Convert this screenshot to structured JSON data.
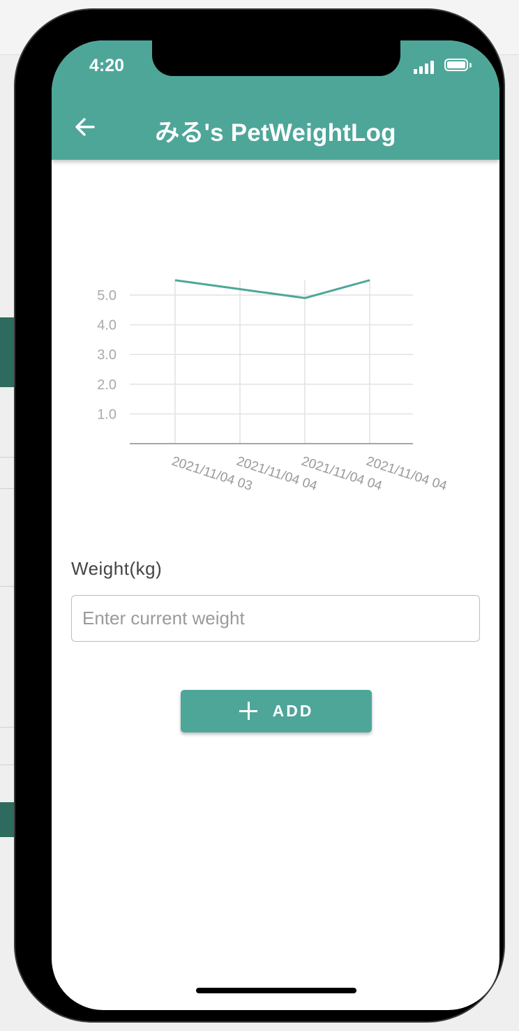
{
  "status_bar": {
    "time": "4:20"
  },
  "app_bar": {
    "title": "みる's PetWeightLog",
    "back_icon": "arrow-left-icon"
  },
  "chart_data": {
    "type": "line",
    "categories": [
      "2021/11/04 03",
      "2021/11/04 04",
      "2021/11/04 04",
      "2021/11/04 04"
    ],
    "series": [
      {
        "values": [
          5.5,
          5.2,
          4.9,
          5.5
        ],
        "color": "#4ea699"
      }
    ],
    "yticks": [
      "1.0",
      "2.0",
      "3.0",
      "4.0",
      "5.0"
    ],
    "ylim": [
      0,
      5.5
    ],
    "grid": true,
    "xlabel": "",
    "ylabel": "",
    "title": ""
  },
  "form": {
    "weight_label": "Weight(kg)",
    "weight_placeholder": "Enter current weight",
    "weight_value": ""
  },
  "add_button": {
    "label": "ADD",
    "icon": "plus-icon"
  },
  "colors": {
    "primary": "#4ea699",
    "background": "#ffffff"
  }
}
